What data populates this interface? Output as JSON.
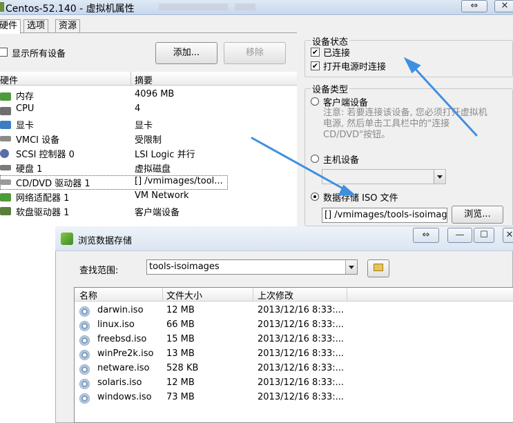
{
  "window": {
    "title": "Centos-52.140 - 虚拟机属性",
    "restore_glyph": "⇔",
    "close_glyph": "✕"
  },
  "tabs": [
    "硬件",
    "选项",
    "资源"
  ],
  "show_all_devices": {
    "label": "显示所有设备",
    "checked": false
  },
  "buttons": {
    "add": "添加...",
    "remove": "移除",
    "browse": "浏览..."
  },
  "hardware_table": {
    "columns": [
      "硬件",
      "摘要"
    ],
    "rows": [
      {
        "name": "内存",
        "summary": "4096 MB",
        "icon": "memory-icon"
      },
      {
        "name": "CPU",
        "summary": "4",
        "icon": "cpu-icon"
      },
      {
        "name": "显卡",
        "summary": "显卡",
        "icon": "display-icon"
      },
      {
        "name": "VMCI 设备",
        "summary": "受限制",
        "icon": "vmci-icon"
      },
      {
        "name": "SCSI 控制器 0",
        "summary": "LSI Logic 并行",
        "icon": "scsi-icon"
      },
      {
        "name": "硬盘 1",
        "summary": "虚拟磁盘",
        "icon": "disk-icon"
      },
      {
        "name": "CD/DVD 驱动器 1",
        "summary": "[] /vmimages/tool...",
        "icon": "cdrom-icon"
      },
      {
        "name": "网络适配器 1",
        "summary": "VM Network",
        "icon": "network-icon"
      },
      {
        "name": "软盘驱动器 1",
        "summary": "客户端设备",
        "icon": "floppy-icon"
      }
    ]
  },
  "device_status": {
    "legend": "设备状态",
    "connected": {
      "label": "已连接",
      "checked": true
    },
    "connect_at_power_on": {
      "label": "打开电源时连接",
      "checked": true
    }
  },
  "device_type": {
    "legend": "设备类型",
    "client_device": "客户端设备",
    "note": "注意: 若要连接该设备, 您必须打开虚拟机电源, 然后单击工具栏中的\"连接 CD/DVD\"按钮。",
    "host_device": "主机设备",
    "datastore_iso": "数据存储 ISO 文件",
    "iso_path": "[] /vmimages/tools-isoimages",
    "selected": "datastore_iso"
  },
  "browse_dialog": {
    "title": "浏览数据存储",
    "lookin_label": "查找范围:",
    "lookin_value": "tools-isoimages",
    "columns": [
      "名称",
      "文件大小",
      "上次修改"
    ],
    "files": [
      {
        "name": "darwin.iso",
        "size": "12 MB",
        "modified": "2013/12/16 8:33:..."
      },
      {
        "name": "linux.iso",
        "size": "66 MB",
        "modified": "2013/12/16 8:33:..."
      },
      {
        "name": "freebsd.iso",
        "size": "15 MB",
        "modified": "2013/12/16 8:33:..."
      },
      {
        "name": "winPre2k.iso",
        "size": "13 MB",
        "modified": "2013/12/16 8:33:..."
      },
      {
        "name": "netware.iso",
        "size": "528 KB",
        "modified": "2013/12/16 8:33:..."
      },
      {
        "name": "solaris.iso",
        "size": "12 MB",
        "modified": "2013/12/16 8:33:..."
      },
      {
        "name": "windows.iso",
        "size": "73 MB",
        "modified": "2013/12/16 8:33:..."
      }
    ]
  },
  "colors": {
    "annotation_arrow": "#3f8fe0",
    "selection_border": "#555555"
  }
}
